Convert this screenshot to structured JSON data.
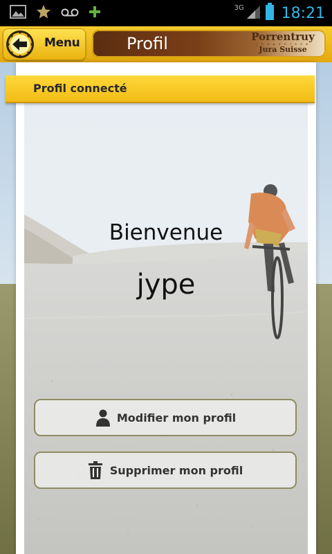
{
  "status_bar": {
    "network": "3G",
    "time": "18:21",
    "icons": [
      "gallery-icon",
      "star-icon",
      "voicemail-icon",
      "plus-icon",
      "signal-icon",
      "battery-icon"
    ]
  },
  "header": {
    "menu_label": "Menu",
    "title": "Profil",
    "brand": {
      "line1": "Porrentruy",
      "line2": "J U R A   S U I S S E",
      "line3": "Jura Suisse"
    }
  },
  "section": {
    "banner": "Profil connecté"
  },
  "main": {
    "welcome": "Bienvenue",
    "username": "jype"
  },
  "actions": {
    "modify_label": "Modifier mon profil",
    "delete_label": "Supprimer mon profil"
  },
  "colors": {
    "accent": "#f2bc16",
    "title_bg": "#5b2d12",
    "clock": "#33b5e5"
  }
}
